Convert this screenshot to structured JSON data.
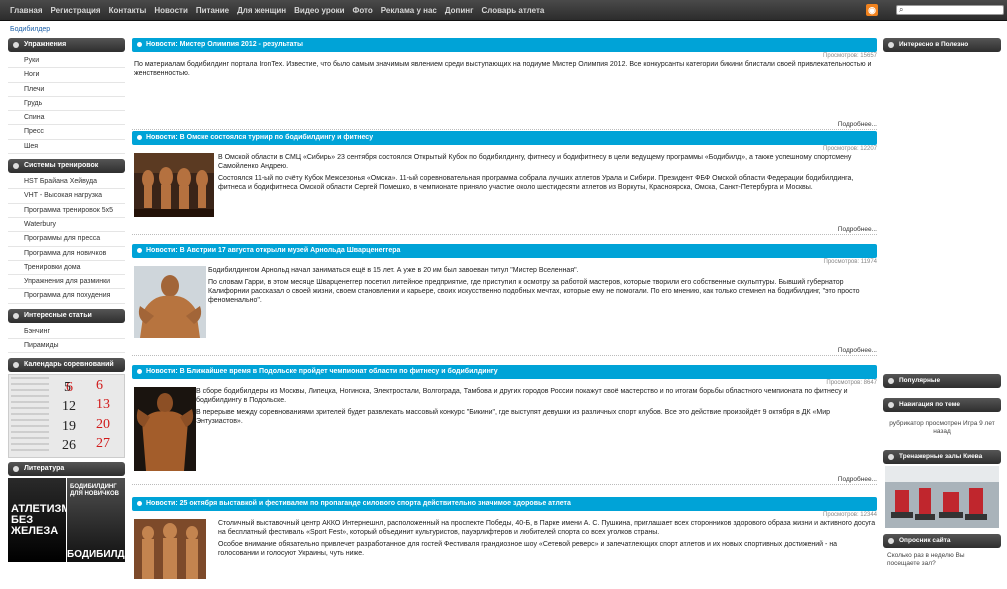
{
  "nav": {
    "items": [
      "Главная",
      "Регистрация",
      "Контакты",
      "Новости",
      "Питание",
      "Для женщин",
      "Видео уроки",
      "Фото",
      "Реклама у нас",
      "Допинг",
      "Словарь атлета"
    ],
    "rss_glyph": "RSS"
  },
  "breadcrumb": "Бодибилдер",
  "left": {
    "groups": [
      {
        "title": "Упражнения",
        "items": [
          "Руки",
          "Ноги",
          "Плечи",
          "Грудь",
          "Спина",
          "Пресс",
          "Шея"
        ]
      },
      {
        "title": "Системы тренировок",
        "items": [
          "HST Брайана Хейвуда",
          "VHT - Высокая нагрузка",
          "Программа тренировок 5x5",
          "Waterbury",
          "Программы для пресса",
          "Программа для новичков",
          "Тренировки дома",
          "Упражнения для разминки",
          "Программа для похудения"
        ]
      },
      {
        "title": "Интересные статьи",
        "items": [
          "Бэнчинг",
          "Пирамиды"
        ]
      }
    ],
    "calendar_title": "Календарь соревнований",
    "calendar_numbers": [
      "6",
      "5",
      "13",
      "12",
      "20",
      "19",
      "27",
      "26"
    ],
    "literature_title": "Литература",
    "book1_title": "АТЛЕТИЗМ БЕЗ ЖЕЛЕЗА",
    "book2_top": "БОДИБИЛДИНГ ДЛЯ НОВИЧКОВ",
    "book2_bottom": "БОДИБИЛДИНГ"
  },
  "news": [
    {
      "title": "Новости: Мистер Олимпия 2012 - результаты",
      "views": "Просмотров: 15657",
      "paragraphs": [
        "По материалам бодибилдинг портала IronTex. Известие, что было самым значимым явлением среди выступающих на подиуме Мистер Олимпия 2012. Все конкурсанты категории бикини блистали своей привлекательностью и женственностью."
      ],
      "more": "Подробнее..."
    },
    {
      "title": "Новости: В Омске состоялся турнир по бодибилдингу и фитнесу",
      "views": "Просмотров: 12207",
      "paragraphs": [
        "В Омской области в СМЦ «Сибирь» 23 сентября состоялся Открытый Кубок по бодибилдингу, фитнесу и бодифитнесу в цели ведущему программы «Бодибилд», а также успешному спортсмену Самойленко Андрею.",
        "Состоялся 11-ый по счёту Кубок Межсезонья «Омска». 11-ый соревновательная программа собрала лучших атлетов Урала и Сибири. Президент ФБФ Омской области Федерации бодибилдинга, фитнеса и бодифитнеса Омской области Сергей Помешко, в чемпионате приняло участие около шестидесяти атлетов из Воркуты, Красноярска, Омска, Санкт-Петербурга и Москвы."
      ],
      "more": "Подробнее..."
    },
    {
      "title": "Новости: В Австрии 17 августа открыли музей Арнольда Шварценеггера",
      "views": "Просмотров: 11974",
      "paragraphs": [
        "Бодибилдингом Арнольд начал заниматься ещё в 15 лет. А уже в 20 им был завоеван титул \"Мистер Вселенная\".",
        "По словам Гарри, в этом месяце Шварценеггер посетил литейное предприятие, где приступил к осмотру за работой мастеров, которые творили его собственные скульптуры. Бывший губернатор Калифорнии рассказал о своей жизни, своем становлении и карьере, своих искусственно подобных мечтах, которые ему не помогали. По его мнению, как только стемнел на бодибилдинг, \"это просто феноменально\"."
      ],
      "more": "Подробнее..."
    },
    {
      "title": "Новости: В Ближайшее время в Подольске пройдет чемпионат области по фитнесу и бодибилдингу",
      "views": "Просмотров: 8647",
      "paragraphs": [
        "В сборе бодибилдеры из Москвы, Липецка, Ногинска, Электростали, Волгограда, Тамбова и других городов России покажут своё мастерство и по итогам борьбы областного чемпионата по фитнесу и бодибилдингу в Подольске.",
        "В перерыве между соревнованиями зрителей будет развлекать массовый конкурс \"Бикини\", где выступят девушки из различных спорт клубов. Все это действие произойдёт 9 октября в ДК «Мир Энтузиастов»."
      ],
      "more": "Подробнее..."
    },
    {
      "title": "Новости: 25 октября выставкой и фестивалем по пропаганде силового спорта действительно значимое здоровье атлета",
      "views": "Просмотров: 12344",
      "paragraphs": [
        "Столичный выставочный центр АККО Интернешнл, расположенный на проспекте Победы, 40-Б, в Парке имени А. С. Пушкина, приглашает всех сторонников здорового образа жизни и активного досуга на бесплатный фестиваль «Sport Fest», который объединит культуристов, пауэрлифтеров и любителей спорта со всех уголков страны.",
        "Особое внимание обязательно привлечет разработанное для гостей Фестиваля грандиозное шоу «Сетевой реверс» и запечатлеющих спорт атлетов и их новых спортивных достижений - на голосовании и голосуют Украины, чуть ниже."
      ],
      "more": ""
    }
  ],
  "right": {
    "interesting_title": "Интересно в Полезно",
    "popular_title": "Популярные",
    "navigation_title": "Навигация по теме",
    "navigation_text": "рубрикатор просмотрен Игра 9 лет назад",
    "trainers_title": "Тренажерные залы Киева",
    "poll_title": "Опросник сайта",
    "poll_text": "Сколько раз в неделю Вы посещаете зал?"
  },
  "colors": {
    "news_bar": "#00a3d7",
    "sidebar_head": "#3a3a3a",
    "calendar_red": "#d11a1a"
  }
}
